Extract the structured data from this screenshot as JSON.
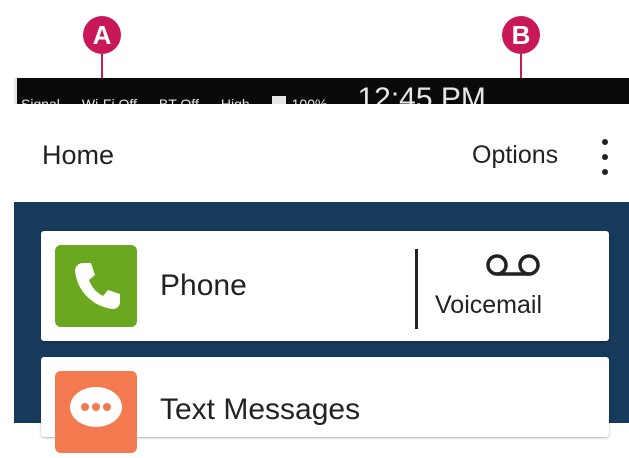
{
  "annotations": {
    "a": "A",
    "b": "B"
  },
  "status_bar": {
    "signal": "Signal",
    "wifi": "Wi-Fi Off",
    "bluetooth": "BT Off",
    "volume": "High",
    "battery": "100%",
    "clock": "12:45 PM"
  },
  "app_bar": {
    "title": "Home",
    "options_label": "Options"
  },
  "cards": {
    "phone": {
      "label": "Phone",
      "voicemail_label": "Voicemail",
      "icon": "phone-icon",
      "color": "#6aa81f"
    },
    "text": {
      "label": "Text Messages",
      "icon": "chat-bubble-icon",
      "color": "#f27a4e"
    }
  },
  "colors": {
    "annotation": "#c8185a",
    "content_background": "#163a5c"
  }
}
